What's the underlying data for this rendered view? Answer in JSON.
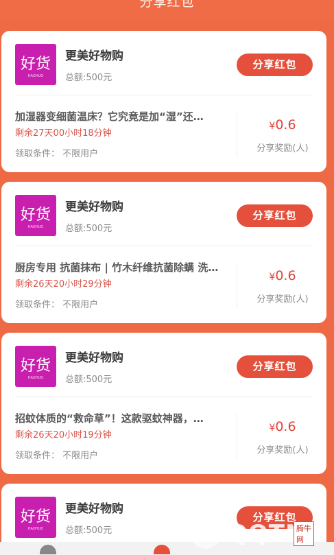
{
  "header": {
    "title": "分享红包"
  },
  "cards": [
    {
      "shop_name": "更美好物购",
      "total": "总额:500元",
      "share_label": "分享红包",
      "article": "加湿器变细菌温床？它究竟是加“湿”还…",
      "remaining": "剩余27天00小时18分钟",
      "condition": "领取条件：  不限用户",
      "reward": "0.6",
      "currency": "¥",
      "reward_label": "分享奖励(人)"
    },
    {
      "shop_name": "更美好物购",
      "total": "总额:500元",
      "share_label": "分享红包",
      "article": "厨房专用 抗菌抹布 | 竹木纤维抗菌除螨 洗…",
      "remaining": "剩余26天20小时29分钟",
      "condition": "领取条件：  不限用户",
      "reward": "0.6",
      "currency": "¥",
      "reward_label": "分享奖励(人)"
    },
    {
      "shop_name": "更美好物购",
      "total": "总额:500元",
      "share_label": "分享红包",
      "article": "招蚊体质的“救命草”！这款驱蚊神器，…",
      "remaining": "剩余26天20小时19分钟",
      "condition": "领取条件：  不限用户",
      "reward": "0.6",
      "currency": "¥",
      "reward_label": "分享奖励(人)"
    },
    {
      "shop_name": "更美好物购",
      "total": "总额:500元",
      "share_label": "分享红包"
    }
  ],
  "logo": {
    "text": "好货",
    "subtext": "HAOHUO",
    "color": "#c81fae"
  },
  "watermark": {
    "text": "QQTN",
    "suffix": ".com",
    "badge": "腾牛网"
  },
  "colors": {
    "background": "#ee6a45",
    "button": "#e4503c",
    "reward": "#e1443a"
  }
}
